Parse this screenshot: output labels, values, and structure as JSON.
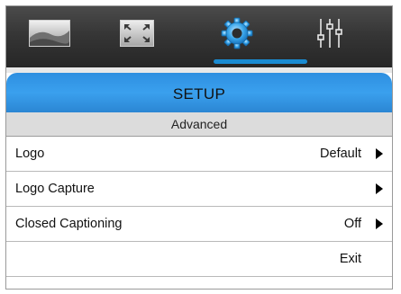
{
  "tabs": [
    {
      "id": "picture",
      "icon": "landscape-picture-icon"
    },
    {
      "id": "display",
      "icon": "fullscreen-arrows-icon"
    },
    {
      "id": "setup",
      "icon": "gear-icon",
      "active": true
    },
    {
      "id": "audio",
      "icon": "equalizer-sliders-icon"
    }
  ],
  "section": {
    "title": "SETUP",
    "subtitle": "Advanced"
  },
  "menu": {
    "items": [
      {
        "label": "Logo",
        "value": "Default",
        "has_submenu": true
      },
      {
        "label": "Logo Capture",
        "value": "",
        "has_submenu": true
      },
      {
        "label": "Closed Captioning",
        "value": "Off",
        "has_submenu": true
      }
    ],
    "exit_label": "Exit"
  },
  "colors": {
    "accent": "#1a8bd2",
    "header_blue": "#3aa0ee",
    "tabbar": "#333333",
    "subheader": "#dcdcdc"
  }
}
